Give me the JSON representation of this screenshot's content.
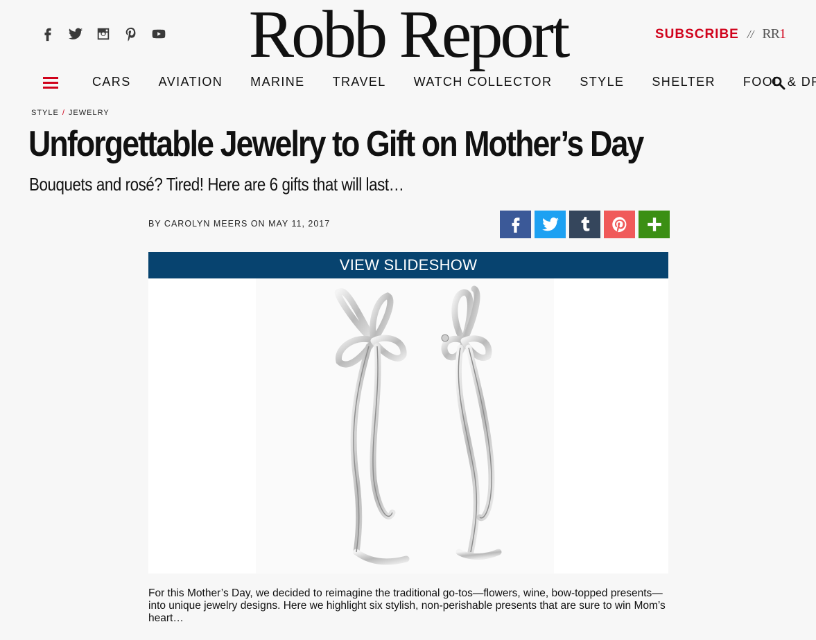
{
  "header": {
    "logo": "Robb Report",
    "subscribe_label": "SUBSCRIBE",
    "separator": "//",
    "rr1_prefix": "RR",
    "rr1_suffix": "1"
  },
  "social": [
    {
      "name": "facebook-icon"
    },
    {
      "name": "twitter-icon"
    },
    {
      "name": "instagram-icon"
    },
    {
      "name": "pinterest-icon"
    },
    {
      "name": "youtube-icon"
    }
  ],
  "nav": {
    "items": [
      "CARS",
      "AVIATION",
      "MARINE",
      "TRAVEL",
      "WATCH COLLECTOR",
      "STYLE",
      "SHELTER",
      "FOOD & DRINK"
    ],
    "menu_icon": "hamburger-menu-icon",
    "search_icon": "search-icon"
  },
  "breadcrumb": {
    "section": "STYLE",
    "separator": "/",
    "subsection": "JEWELRY"
  },
  "article": {
    "title": "Unforgettable Jewelry to Gift on Mother’s Day",
    "dek": "Bouquets and rosé? Tired! Here are 6 gifts that will last…",
    "byline_prefix": "BY ",
    "author": "CAROLYN MEERS",
    "byline_mid": " ON ",
    "date": "MAY 11, 2017",
    "slideshow_label": "VIEW SLIDESHOW",
    "caption": "For this Mother’s Day, we decided to reimagine the traditional go-tos—flowers, wine, bow-topped presents—into unique jewelry designs. Here we highlight six stylish, non-perishable presents that are sure to win Mom’s heart…"
  },
  "share": [
    {
      "name": "facebook-share",
      "color": "#3b5998"
    },
    {
      "name": "twitter-share",
      "color": "#1da1f2"
    },
    {
      "name": "tumblr-share",
      "color": "#35465c"
    },
    {
      "name": "pinterest-share",
      "color": "#f05a5a"
    },
    {
      "name": "more-share",
      "color": "#3b8f14"
    }
  ],
  "colors": {
    "accent": "#d0021b",
    "slideshow_bar": "#07436f"
  }
}
